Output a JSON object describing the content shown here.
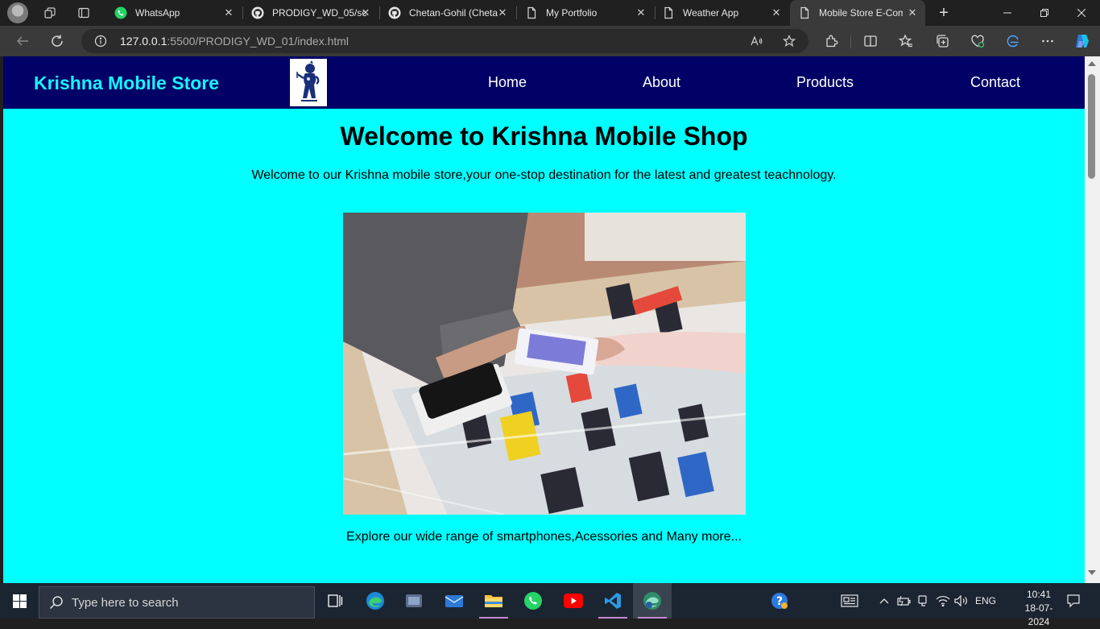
{
  "browser": {
    "tabs": [
      {
        "title": "WhatsApp",
        "icon": "whatsapp-icon"
      },
      {
        "title": "PRODIGY_WD_05/sc",
        "icon": "github-icon"
      },
      {
        "title": "Chetan-Gohil (Chetan",
        "icon": "github-icon"
      },
      {
        "title": "My Portfolio",
        "icon": "page-icon"
      },
      {
        "title": "Weather App",
        "icon": "page-icon"
      },
      {
        "title": "Mobile Store E-Com",
        "icon": "page-icon",
        "active": true
      }
    ],
    "url_host": "127.0.0.1",
    "url_path": ":5500/PRODIGY_WD_01/index.html"
  },
  "site": {
    "brand": "Krishna Mobile Store",
    "nav": {
      "home": "Home",
      "about": "About",
      "products": "Products",
      "contact": "Contact"
    },
    "title": "Welcome to Krishna Mobile Shop",
    "intro": "Welcome to our Krishna mobile store,your one-stop destination for the latest and greatest teachnology.",
    "explore": "Explore our wide range of smartphones,Acessories and Many more...",
    "colors": {
      "background": "#00ffff",
      "navbar": "#000066",
      "brand": "#19f3ff"
    }
  },
  "taskbar": {
    "search_placeholder": "Type here to search",
    "apps": [
      "task-view-icon",
      "edge-icon",
      "media-player-icon",
      "mail-icon",
      "file-explorer-icon",
      "whatsapp-icon",
      "youtube-icon",
      "vscode-icon",
      "edge-dev-icon"
    ],
    "language": "ENG",
    "time": "10:41",
    "date": "18-07-2024"
  }
}
